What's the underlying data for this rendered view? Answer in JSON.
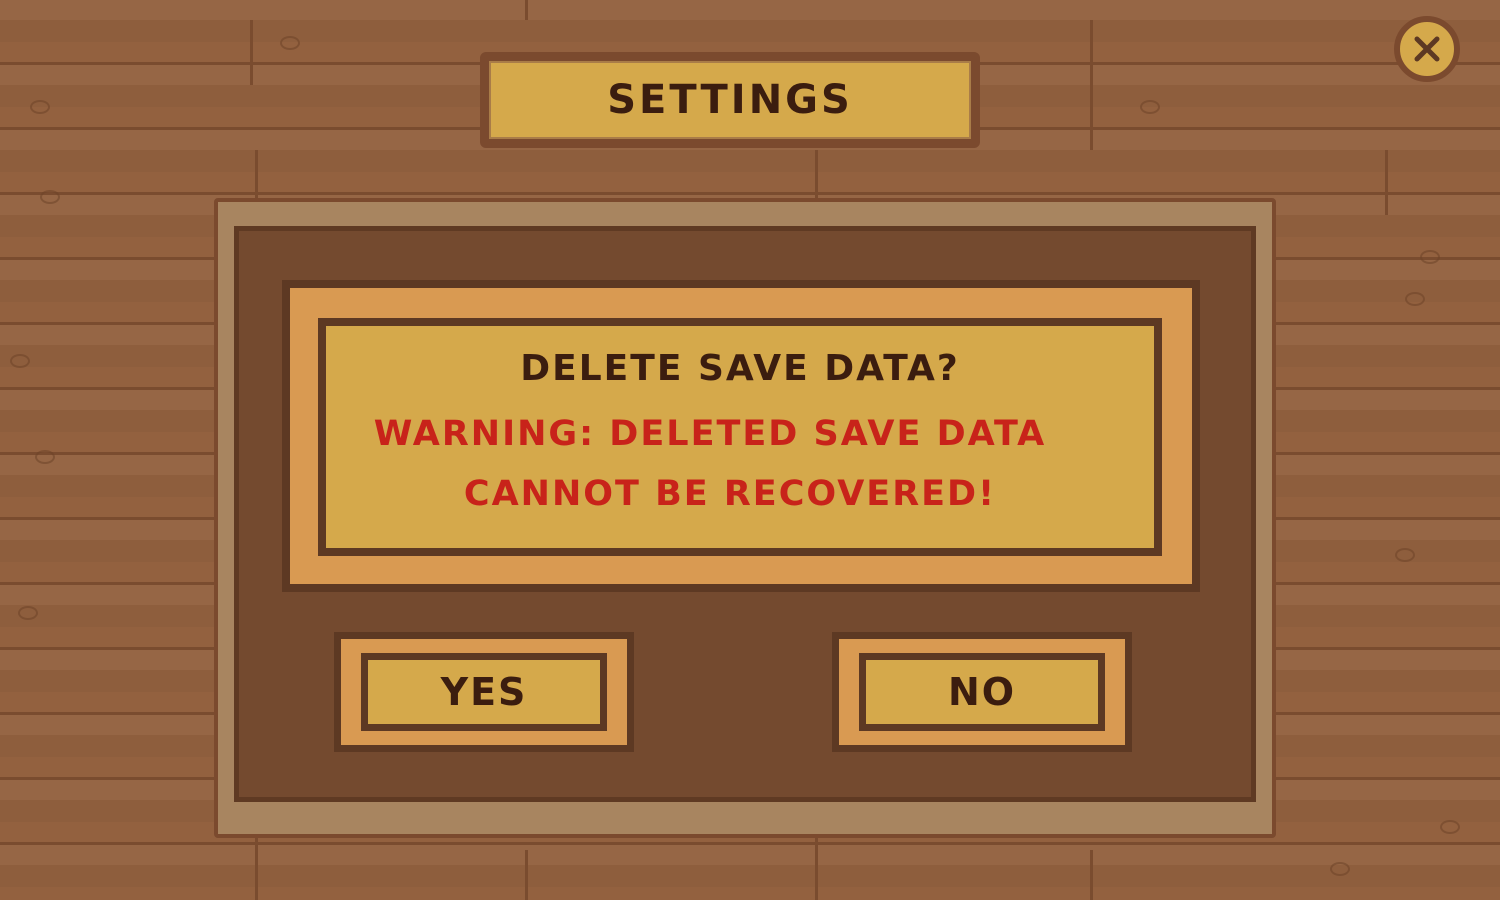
{
  "header": {
    "title": "SETTINGS"
  },
  "close_button": {
    "icon": "close-icon"
  },
  "dialog": {
    "question": "DELETE SAVE DATA?",
    "warning_line1": "WARNING: DELETED SAVE DATA",
    "warning_line2": "CANNOT BE RECOVERED!",
    "yes_label": "YES",
    "no_label": "NO"
  },
  "colors": {
    "wood_background": "#93613f",
    "plate_yellow": "#d5a94b",
    "plate_orange": "#d99a52",
    "dark_brown": "#5d3923",
    "text_dark": "#3b1d0f",
    "warning_red": "#c8231a"
  }
}
